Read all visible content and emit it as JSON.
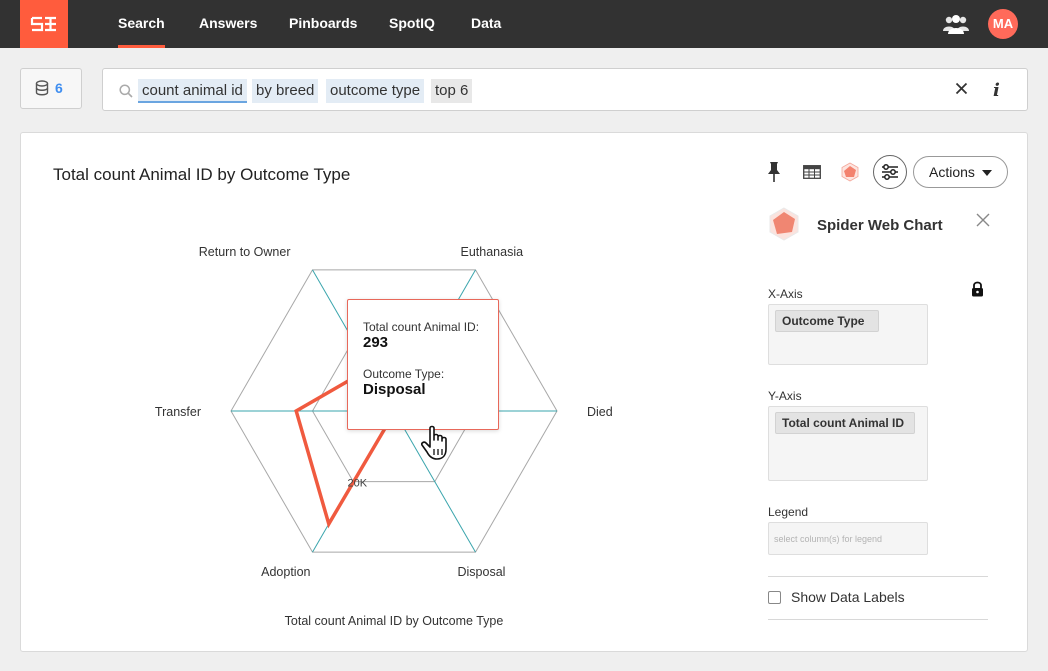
{
  "nav": {
    "logo_icon": "thoughtspot-logo-icon",
    "items": [
      {
        "label": "Search",
        "active": true
      },
      {
        "label": "Answers",
        "active": false
      },
      {
        "label": "Pinboards",
        "active": false
      },
      {
        "label": "SpotIQ",
        "active": false
      },
      {
        "label": "Data",
        "active": false
      }
    ],
    "user_initials": "MA",
    "colors": {
      "bar": "#323232",
      "accent": "#ff5c3d",
      "avatar": "#ff6a5a"
    }
  },
  "search": {
    "source_count": "6",
    "tokens": [
      "count animal id",
      "by breed",
      "outcome type",
      "top 6"
    ]
  },
  "answer": {
    "title": "Total count Animal ID by Outcome Type",
    "actions_label": "Actions",
    "toolbar_icons": [
      "pin-icon",
      "table-icon",
      "spider-chart-icon",
      "settings-sliders-icon"
    ]
  },
  "chart_data": {
    "type": "radar",
    "title": "Total count Animal ID by Outcome Type",
    "categories": [
      "Euthanasia",
      "Died",
      "Disposal",
      "Adoption",
      "Transfer",
      "Return to Owner"
    ],
    "series": [
      {
        "values": [
          12000,
          2000,
          293,
          32000,
          24000,
          12000
        ],
        "color": "#f05a3f"
      }
    ],
    "axis_max": 40000,
    "ticks": [
      {
        "value": 0,
        "label": "0"
      },
      {
        "value": 20000,
        "label": "20K"
      }
    ],
    "highlighted": {
      "category": "Disposal",
      "value": 293
    },
    "colors": {
      "grid": "#a8a8a8",
      "spoke": "#3aa5ad",
      "series": "#f05a3f"
    }
  },
  "tooltip": {
    "metric_label": "Total count Animal ID:",
    "metric_value": "293",
    "dim_label": "Outcome Type:",
    "dim_value": "Disposal"
  },
  "settings_panel": {
    "chart_type": "Spider Web Chart",
    "x_axis_label": "X-Axis",
    "x_axis_value": "Outcome Type",
    "y_axis_label": "Y-Axis",
    "y_axis_value": "Total count Animal ID",
    "legend_label": "Legend",
    "legend_placeholder": "select column(s) for legend",
    "show_data_labels": "Show Data Labels",
    "show_data_labels_checked": false
  }
}
